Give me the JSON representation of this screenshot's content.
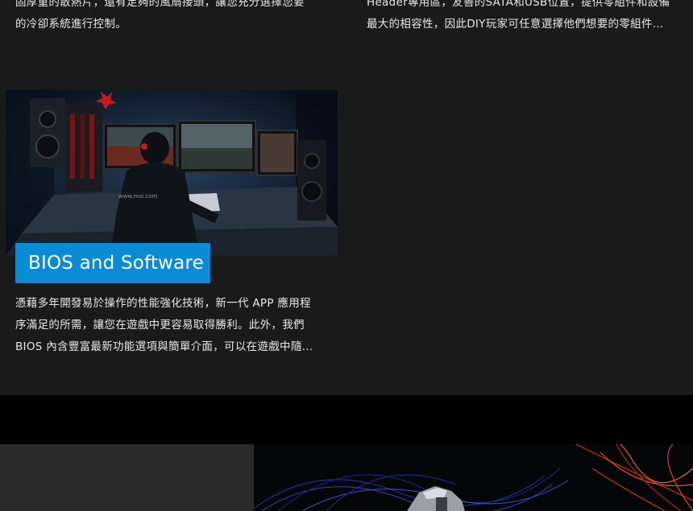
{
  "features": {
    "left_top": {
      "lines": [
        "固厚重的散熱片，還有足夠的風扇接頭，讓您充分選擇您要",
        "的冷卻系統進行控制。"
      ]
    },
    "right_top": {
      "lines": [
        "Header專用區，友善的SATA和USB位置，提供零組件和設備",
        "最大的相容性，因此DIY玩家可任意選擇他們想要的零組件..."
      ]
    },
    "bios": {
      "title": "BIOS and Software",
      "lines": [
        "憑藉多年開發易於操作的性能強化技術，新一代 APP 應用程",
        "序滿足的所需，讓您在遊戲中更容易取得勝利。此外，我們",
        "BIOS 內含豐富最新功能選項與簡單介面，可以在遊戲中隨..."
      ],
      "image_caption": "www.msi.com"
    }
  },
  "colors": {
    "section_bg": "#1a1a1a",
    "badge_blue": "#0a8bd6",
    "panel_gray": "#2a2a2a"
  }
}
